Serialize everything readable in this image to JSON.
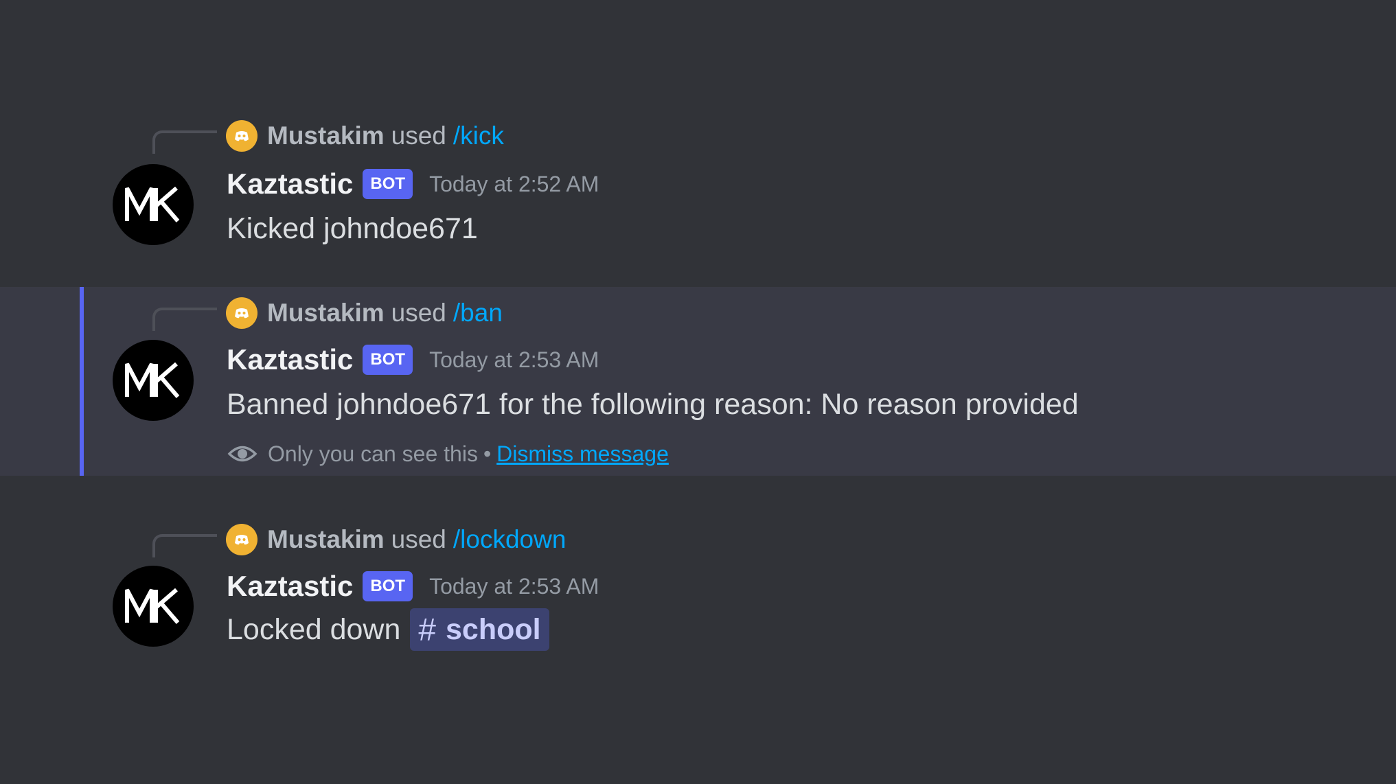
{
  "colors": {
    "background": "#313338",
    "highlight_background": "#393a45",
    "highlight_bar": "#5865f2",
    "bot_badge": "#5865f2",
    "command_link": "#00a8fc",
    "mini_avatar": "#f0b232"
  },
  "messages": [
    {
      "command_user": "Mustakim",
      "command_used_text": "used",
      "command_name": "/kick",
      "author": "Kaztastic",
      "badge": "BOT",
      "timestamp": "Today at 2:52 AM",
      "content": "Kicked johndoe671",
      "avatar_icon": "mk-logo-icon"
    },
    {
      "command_user": "Mustakim",
      "command_used_text": "used",
      "command_name": "/ban",
      "author": "Kaztastic",
      "badge": "BOT",
      "timestamp": "Today at 2:53 AM",
      "content": "Banned johndoe671 for the following reason: No reason provided",
      "avatar_icon": "mk-logo-icon",
      "ephemeral": {
        "icon": "eye-icon",
        "notice": "Only you can see this",
        "separator": "•",
        "dismiss_label": "Dismiss message"
      }
    },
    {
      "command_user": "Mustakim",
      "command_used_text": "used",
      "command_name": "/lockdown",
      "author": "Kaztastic",
      "badge": "BOT",
      "timestamp": "Today at 2:53 AM",
      "content": "Locked down",
      "avatar_icon": "mk-logo-icon",
      "channel_mention": {
        "hash": "#",
        "name": "school"
      }
    }
  ]
}
